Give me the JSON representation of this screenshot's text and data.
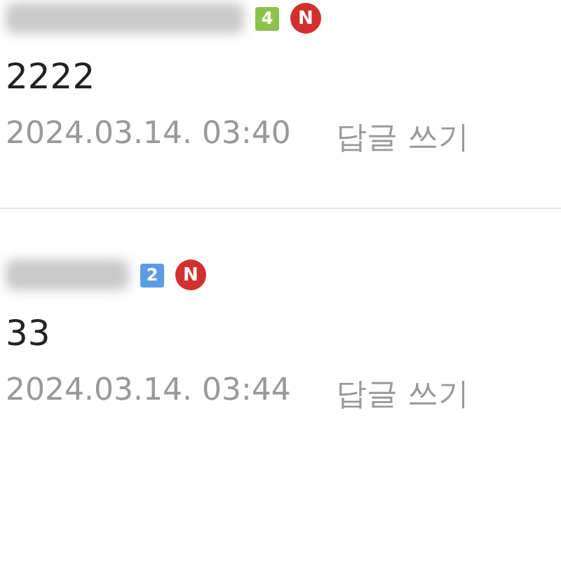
{
  "comments": [
    {
      "level": "4",
      "color": "#8bc34a",
      "new_badge": "N",
      "text": "2222",
      "date": "2024.03.14. 03:40",
      "reply": "답글 쓰기"
    },
    {
      "level": "2",
      "color": "#5c9ce6",
      "new_badge": "N",
      "text": "33",
      "date": "2024.03.14. 03:44",
      "reply": "답글 쓰기"
    }
  ]
}
